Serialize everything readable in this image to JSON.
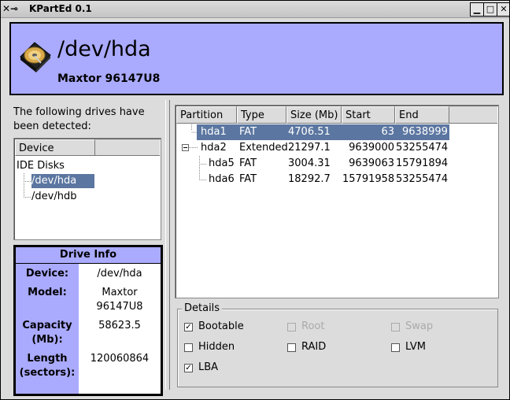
{
  "window": {
    "title": "KPartEd 0.1"
  },
  "header": {
    "device": "/dev/hda",
    "model": "Maxtor 96147U8"
  },
  "intro": "The following drives have been detected:",
  "device_tree": {
    "column": "Device",
    "group": "IDE Disks",
    "items": [
      "/dev/hda",
      "/dev/hdb"
    ],
    "selected": "/dev/hda"
  },
  "drive_info": {
    "title": "Drive Info",
    "device_label": "Device:",
    "device": "/dev/hda",
    "model_label": "Model:",
    "model_line1": "Maxtor",
    "model_line2": "96147U8",
    "capacity_label_1": "Capacity",
    "capacity_label_2": "(Mb):",
    "capacity": "58623.5",
    "length_label_1": "Length",
    "length_label_2": "(sectors):",
    "length": "120060864"
  },
  "partitions": {
    "columns": [
      "Partition",
      "Type",
      "Size (Mb)",
      "Start",
      "End"
    ],
    "rows": [
      {
        "name": "hda1",
        "type": "FAT",
        "size": "4706.51",
        "start": "63",
        "end": "9638999"
      },
      {
        "name": "hda2",
        "type": "Extended",
        "size": "21297.1",
        "start": "9639000",
        "end": "53255474"
      },
      {
        "name": "hda5",
        "type": "FAT",
        "size": "3004.31",
        "start": "9639063",
        "end": "15791894"
      },
      {
        "name": "hda6",
        "type": "FAT",
        "size": "18292.7",
        "start": "15791958",
        "end": "53255474"
      }
    ]
  },
  "details": {
    "title": "Details",
    "bootable": {
      "label": "Bootable",
      "checked": true
    },
    "root": {
      "label": "Root",
      "checked": false
    },
    "swap": {
      "label": "Swap",
      "checked": false
    },
    "hidden": {
      "label": "Hidden",
      "checked": false
    },
    "raid": {
      "label": "RAID",
      "checked": false
    },
    "lvm": {
      "label": "LVM",
      "checked": false
    },
    "lba": {
      "label": "LBA",
      "checked": true
    }
  },
  "colors": {
    "accent": "#aaaaff",
    "selection": "#5b76a0"
  }
}
